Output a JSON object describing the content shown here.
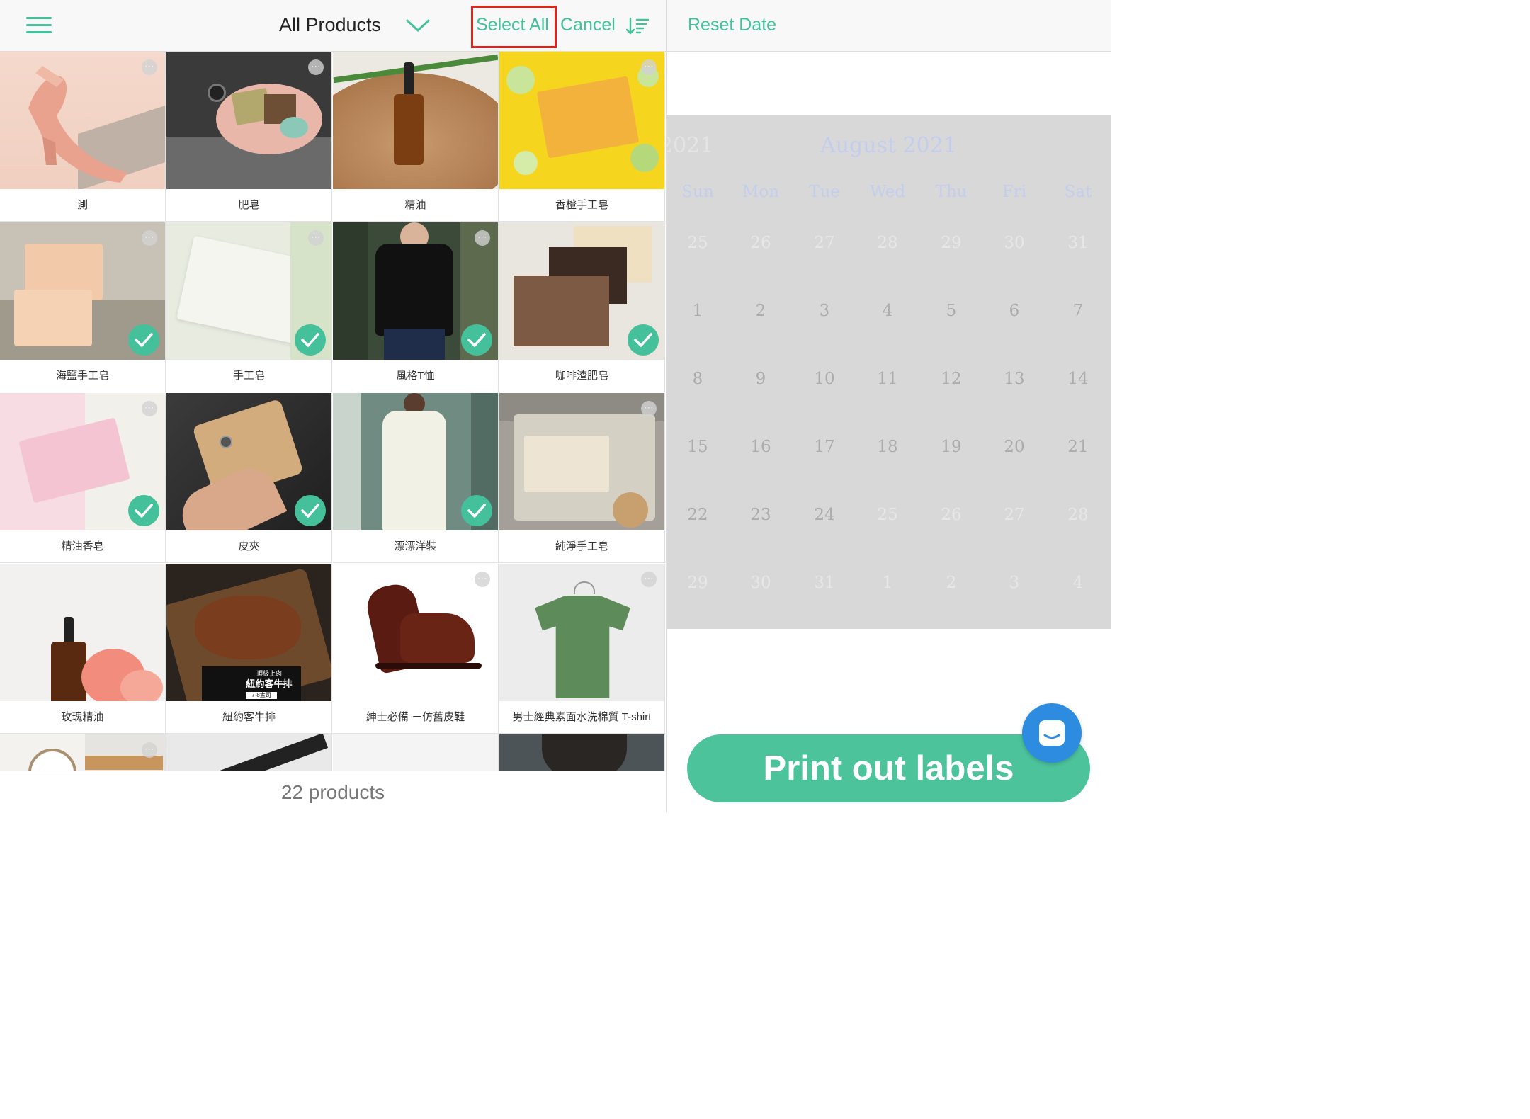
{
  "header": {
    "title": "All Products",
    "select_all": "Select All",
    "cancel": "Cancel",
    "reset_date": "Reset Date"
  },
  "products": [
    {
      "name": "測",
      "selected": false,
      "more": true
    },
    {
      "name": "肥皂",
      "selected": false,
      "more": true
    },
    {
      "name": "精油",
      "selected": false,
      "more": false
    },
    {
      "name": "香橙手工皂",
      "selected": false,
      "more": true
    },
    {
      "name": "海鹽手工皂",
      "selected": true,
      "more": true
    },
    {
      "name": "手工皂",
      "selected": true,
      "more": true
    },
    {
      "name": "風格T恤",
      "selected": true,
      "more": true
    },
    {
      "name": "咖啡渣肥皂",
      "selected": true,
      "more": false
    },
    {
      "name": "精油香皂",
      "selected": true,
      "more": true
    },
    {
      "name": "皮夾",
      "selected": true,
      "more": false
    },
    {
      "name": "漂漂洋裝",
      "selected": true,
      "more": false
    },
    {
      "name": "純淨手工皂",
      "selected": false,
      "more": true
    },
    {
      "name": "玫瑰精油",
      "selected": false,
      "more": false
    },
    {
      "name": "紐約客牛排",
      "selected": false,
      "more": false
    },
    {
      "name": "紳士必備 －仿舊皮鞋",
      "selected": false,
      "more": true
    },
    {
      "name": "男士經典素面水洗棉質 T-shirt",
      "selected": false,
      "more": true
    },
    {
      "name": "",
      "selected": false,
      "more": true
    },
    {
      "name": "",
      "selected": false,
      "more": false
    },
    {
      "name": "",
      "selected": false,
      "more": false
    },
    {
      "name": "",
      "selected": false,
      "more": false
    }
  ],
  "steak_overlay": {
    "line1": "頂級上肉",
    "line2": "紐約客牛排",
    "line3": "7-8盎司"
  },
  "footer": {
    "count": "22 products"
  },
  "calendar": {
    "prev_fragment": "2021",
    "month": "August 2021",
    "weekdays": [
      "Sun",
      "Mon",
      "Tue",
      "Wed",
      "Thu",
      "Fri",
      "Sat"
    ],
    "weeks": [
      [
        {
          "d": "25",
          "out": true
        },
        {
          "d": "26",
          "out": true
        },
        {
          "d": "27",
          "out": true
        },
        {
          "d": "28",
          "out": true
        },
        {
          "d": "29",
          "out": true
        },
        {
          "d": "30",
          "out": true
        },
        {
          "d": "31",
          "out": true
        }
      ],
      [
        {
          "d": "1",
          "out": false
        },
        {
          "d": "2",
          "out": false
        },
        {
          "d": "3",
          "out": false
        },
        {
          "d": "4",
          "out": false
        },
        {
          "d": "5",
          "out": false
        },
        {
          "d": "6",
          "out": false
        },
        {
          "d": "7",
          "out": false
        }
      ],
      [
        {
          "d": "8",
          "out": false
        },
        {
          "d": "9",
          "out": false
        },
        {
          "d": "10",
          "out": false
        },
        {
          "d": "11",
          "out": false
        },
        {
          "d": "12",
          "out": false
        },
        {
          "d": "13",
          "out": false
        },
        {
          "d": "14",
          "out": false
        }
      ],
      [
        {
          "d": "15",
          "out": false
        },
        {
          "d": "16",
          "out": false
        },
        {
          "d": "17",
          "out": false
        },
        {
          "d": "18",
          "out": false
        },
        {
          "d": "19",
          "out": false
        },
        {
          "d": "20",
          "out": false
        },
        {
          "d": "21",
          "out": false
        }
      ],
      [
        {
          "d": "22",
          "out": false
        },
        {
          "d": "23",
          "out": false
        },
        {
          "d": "24",
          "out": false
        },
        {
          "d": "25",
          "out": true
        },
        {
          "d": "26",
          "out": true
        },
        {
          "d": "27",
          "out": true
        },
        {
          "d": "28",
          "out": true
        }
      ],
      [
        {
          "d": "29",
          "out": true
        },
        {
          "d": "30",
          "out": true
        },
        {
          "d": "31",
          "out": true
        },
        {
          "d": "1",
          "out": true
        },
        {
          "d": "2",
          "out": true
        },
        {
          "d": "3",
          "out": true
        },
        {
          "d": "4",
          "out": true
        }
      ]
    ]
  },
  "actions": {
    "print": "Print out labels"
  },
  "colors": {
    "accent": "#44c09b",
    "highlight": "#e0241b",
    "chat": "#2e8ce0"
  }
}
